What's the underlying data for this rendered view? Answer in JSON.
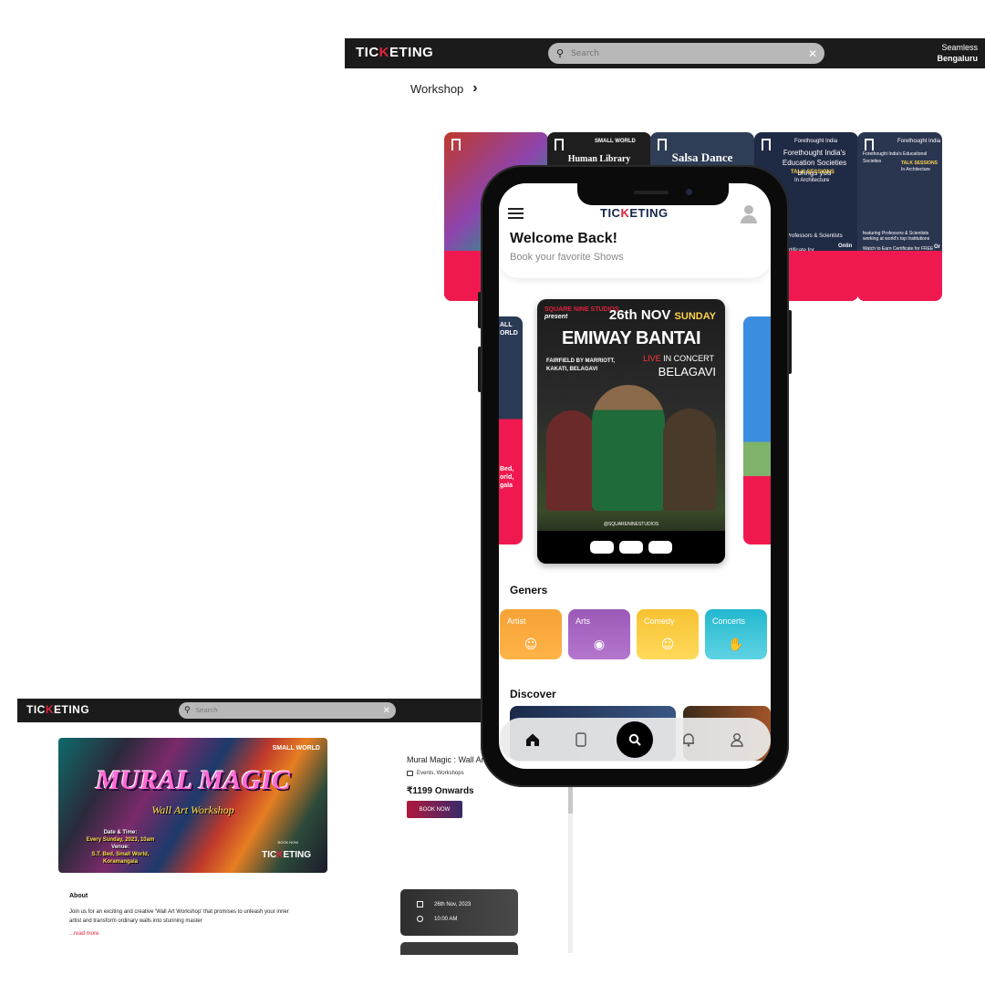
{
  "desktop_top": {
    "logo_pre": "TIC",
    "logo_mark": "K",
    "logo_post": "ETING",
    "search_placeholder": "Search",
    "location_label": "Seamless",
    "location_city": "Bengaluru",
    "breadcrumb": "Workshop"
  },
  "cards": [
    {
      "title": ""
    },
    {
      "brand": "SMALL WORLD",
      "title": "Human Library"
    },
    {
      "title": "Salsa Dance"
    },
    {
      "brand": "Forethought India",
      "title": "Forethought India's Education Societies brings you",
      "tag": "TALK SESSIONS",
      "sub": "In Architecture",
      "foot": "featuring Professors & Scientists working at",
      "foot2": "Certificate for",
      "foot3": "Onlin"
    },
    {
      "brand": "Forethought India",
      "title": "Forethought India's Educational Societies",
      "tag": "TALK SESSIONS",
      "sub": "In Architecture",
      "foot": "featuring Professors & Scientists working at world's top Institutions",
      "foot2": "Watch to Earn Certificate for FREE",
      "foot3": "Or"
    }
  ],
  "phone": {
    "logo_pre": "TIC",
    "logo_mark": "K",
    "logo_post": "ETING",
    "welcome": "Welcome Back!",
    "welcome_sub": "Book your favorite Shows",
    "left_card_text": [
      "ALL",
      "ORLD"
    ],
    "left_card_text2": [
      "Bed,",
      "orld,",
      "gala"
    ],
    "poster": {
      "studio": "SQUARE NINE STUDIOS",
      "presents": "present",
      "date": "26th NOV",
      "day": "SUNDAY",
      "name": "EMIWAY BANTAI",
      "live": "LIVE",
      "concert": " IN CONCERT",
      "city": "BELAGAVI",
      "venue_line1": "FAIRFIELD BY MARRIOTT,",
      "venue_line2": "KAKATI, BELAGAVI",
      "handle": "@SQUARENINESTUDIOS"
    },
    "geners_title": "Geners",
    "genres": [
      {
        "label": "Artist",
        "icon": "users-icon"
      },
      {
        "label": "Arts",
        "icon": "palette-icon"
      },
      {
        "label": "Comedy",
        "icon": "smile-icon"
      },
      {
        "label": "Concerts",
        "icon": "rock-hand-icon"
      }
    ],
    "discover_title": "Discover",
    "nav": [
      "home-icon",
      "phone-icon",
      "search-icon",
      "bell-icon",
      "user-icon"
    ]
  },
  "desktop_bottom": {
    "logo_pre": "TIC",
    "logo_mark": "K",
    "logo_post": "ETING",
    "search_placeholder": "Search",
    "banner": {
      "brand": "SMALL WORLD",
      "title": "MURAL MAGIC",
      "subtitle": "Wall Art Workshop",
      "date_label": "Date & Time:",
      "date_value": "Every Sunday, 2023, 10am",
      "venue_label": "Venue:",
      "venue_value": "S.T. Bed, Small World, Koramangala",
      "book_now": "BOOK NOW",
      "logo_pre": "TIC",
      "logo_mark": "K",
      "logo_post": "ETING"
    },
    "event_title": "Mural Magic : Wall Art Workshop",
    "event_categories": "Events, Workshops",
    "price": "₹1199 Onwards",
    "book_button": "BOOK NOW",
    "about_title": "About",
    "about_text": "Join us for an exciting and creative 'Wall Art Workshop' that promises to unleash your inner artist and transform ordinary walls into stunning master",
    "read_more": "...read more",
    "date": "26th Nov, 2023",
    "time": "10:00 AM"
  },
  "colors": {
    "accent": "#e0243f",
    "dark_bar": "#1b1b1b",
    "artist": "#f6a236",
    "arts": "#9b59b6",
    "comedy": "#f7c232",
    "concerts": "#22b8cf"
  }
}
